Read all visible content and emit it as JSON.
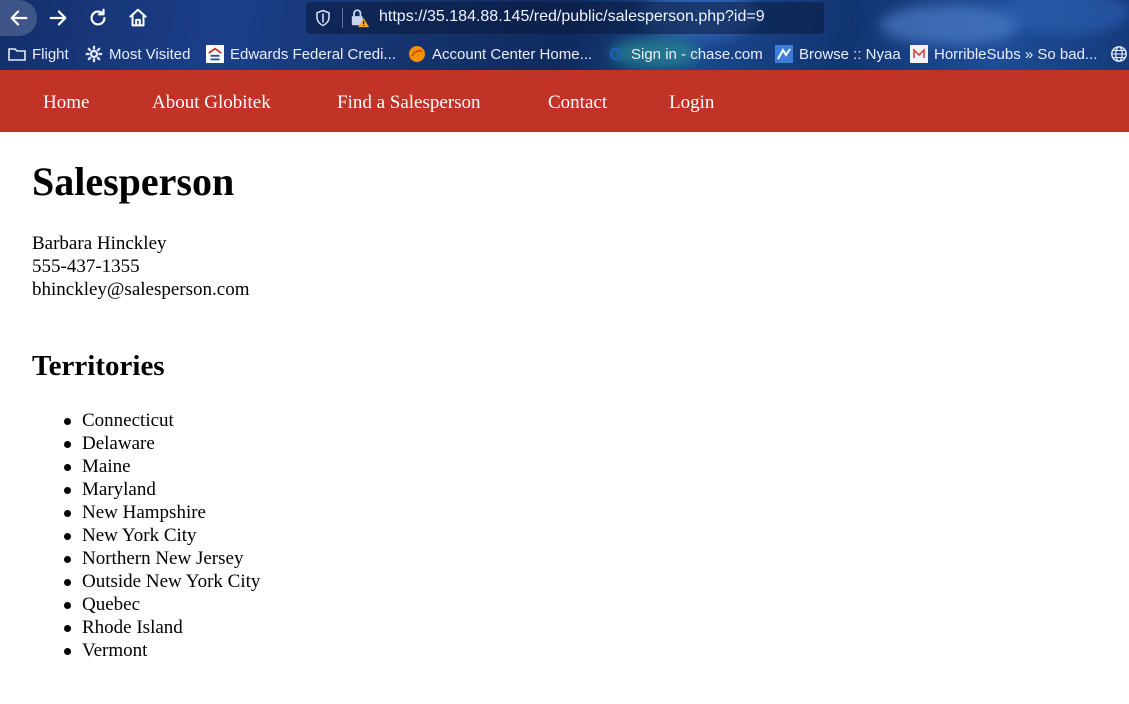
{
  "browser": {
    "url": "https://35.184.88.145/red/public/salesperson.php?id=9",
    "bookmarks": [
      {
        "label": "Flight",
        "icon": "folder-icon"
      },
      {
        "label": "Most Visited",
        "icon": "gear-icon"
      },
      {
        "label": "Edwards Federal Credi...",
        "icon": "bank-icon"
      },
      {
        "label": "Account Center Home...",
        "icon": "orange-circle-icon"
      },
      {
        "label": "Sign in - chase.com",
        "icon": "chase-icon"
      },
      {
        "label": "Browse :: Nyaa",
        "icon": "nyaa-icon"
      },
      {
        "label": "HorribleSubs » So bad...",
        "icon": "page-icon"
      }
    ]
  },
  "nav": {
    "items": [
      "Home",
      "About Globitek",
      "Find a Salesperson",
      "Contact",
      "Login"
    ]
  },
  "page": {
    "title": "Salesperson",
    "name": "Barbara Hinckley",
    "phone": "555-437-1355",
    "email": "bhinckley@salesperson.com",
    "territories_heading": "Territories",
    "territories": [
      "Connecticut",
      "Delaware",
      "Maine",
      "Maryland",
      "New Hampshire",
      "New York City",
      "Northern New Jersey",
      "Outside New York City",
      "Quebec",
      "Rhode Island",
      "Vermont"
    ]
  },
  "colors": {
    "nav_background": "#c03326",
    "text": "#000000"
  }
}
